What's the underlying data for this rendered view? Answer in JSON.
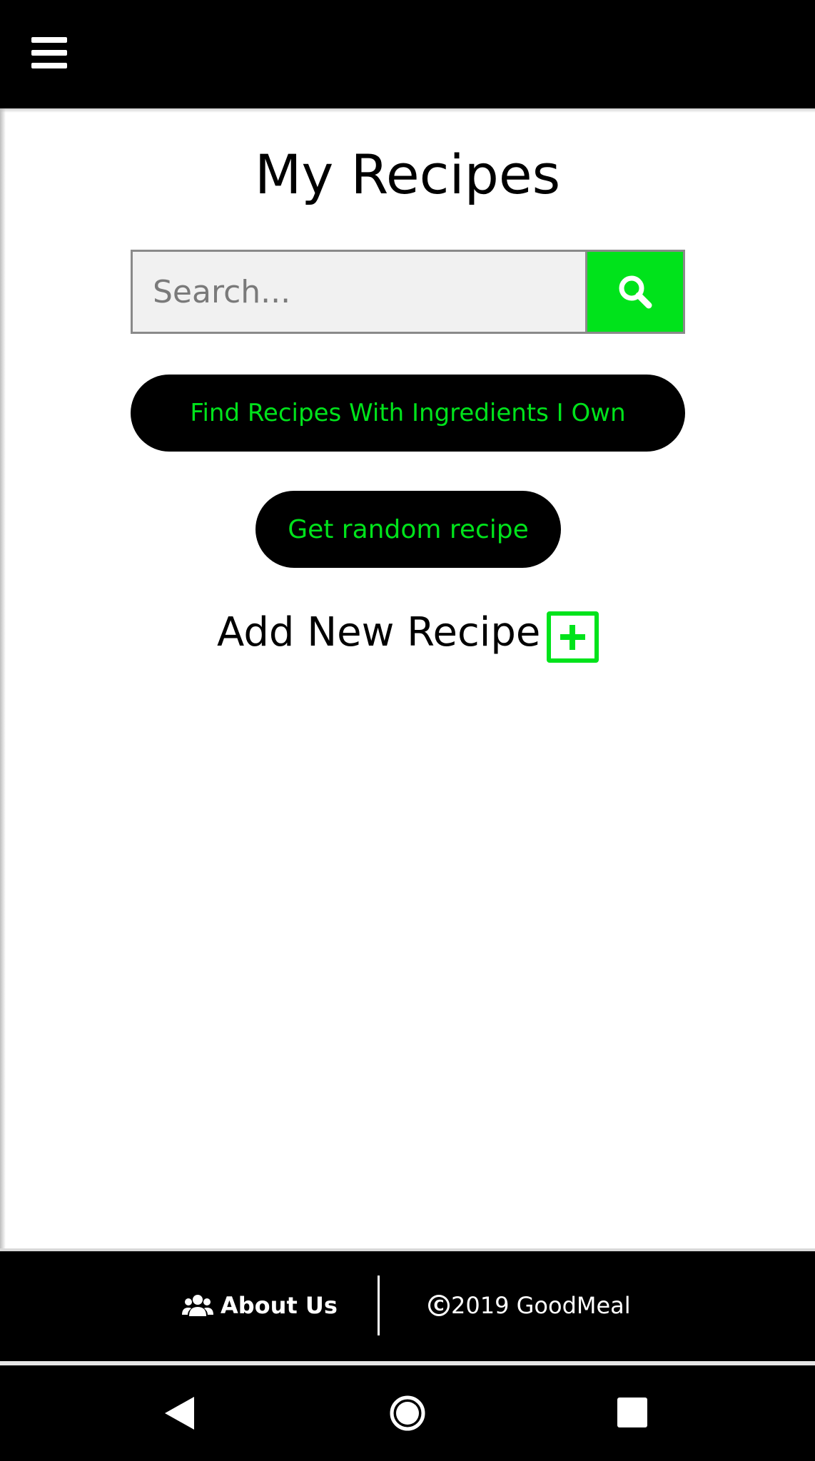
{
  "header": {
    "menu_icon": "hamburger-menu-icon"
  },
  "main": {
    "title": "My Recipes",
    "search": {
      "placeholder": "Search...",
      "value": "",
      "button_icon": "search-icon"
    },
    "find_by_ingredients_label": "Find Recipes With Ingredients I Own",
    "random_recipe_label": "Get random recipe",
    "add_new_recipe_label": "Add New Recipe",
    "add_icon": "plus-square-icon"
  },
  "footer": {
    "about_label": "About Us",
    "about_icon": "users-icon",
    "copyright_symbol": "C",
    "copyright_text": "2019 GoodMeal"
  },
  "system_nav": {
    "back_icon": "back-triangle-icon",
    "home_icon": "home-circle-icon",
    "recents_icon": "recents-square-icon"
  },
  "colors": {
    "accent": "#00e31b",
    "bar": "#000000",
    "background": "#ffffff",
    "search_field": "#f1f1f1"
  }
}
